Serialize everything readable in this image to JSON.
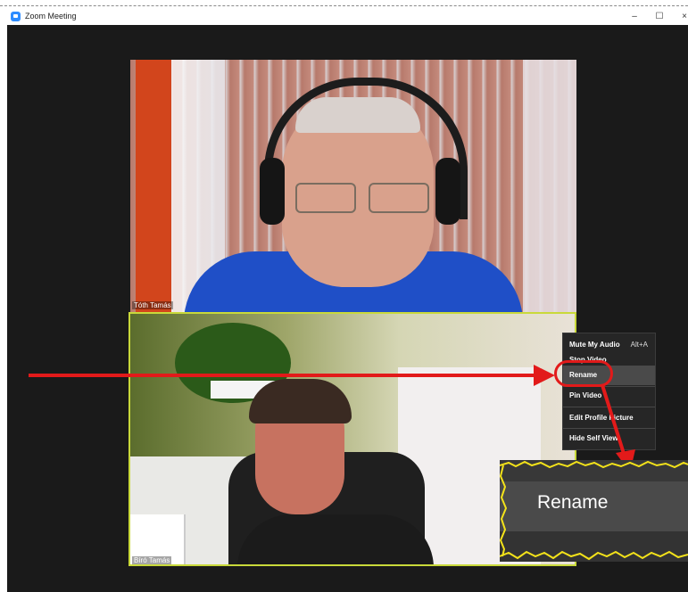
{
  "window": {
    "title": "Zoom Meeting",
    "minimize": "–",
    "maximize": "☐",
    "close": "×"
  },
  "participants": [
    {
      "name": "Tóth Tamás"
    },
    {
      "name": "Bíró Tamás"
    }
  ],
  "context_menu": {
    "items": [
      {
        "label": "Mute My Audio",
        "shortcut": "Alt+A"
      },
      {
        "label": "Stop Video"
      },
      {
        "label": "Rename"
      },
      {
        "label": "Pin Video"
      },
      {
        "label": "Edit Profile Picture"
      },
      {
        "label": "Hide Self View"
      }
    ],
    "highlighted": "Rename"
  },
  "callout": {
    "label": "Rename"
  },
  "colors": {
    "annotation_red": "#e21a1a",
    "active_speaker_border": "#c9d93a",
    "callout_edge": "#f3e21a",
    "meeting_background": "#1a1a1a"
  },
  "icons": {
    "app": "zoom-camera-icon",
    "arrow": "red-arrow-annotation"
  }
}
